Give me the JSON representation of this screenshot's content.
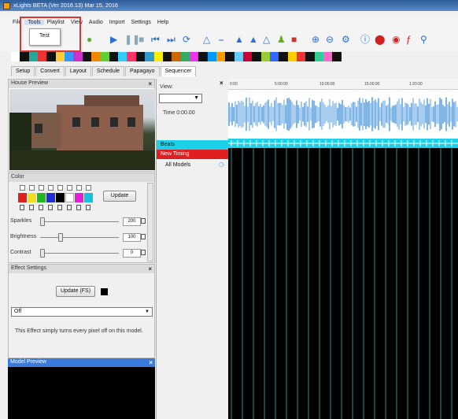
{
  "window": {
    "title": "xLights BETA (Ver 2016.13) Mar 15, 2016"
  },
  "menu": {
    "items": [
      "File",
      "Tools",
      "Playlist",
      "View",
      "Audio",
      "Import",
      "Settings",
      "Help"
    ],
    "active_index": 1,
    "dropdown_items": [
      "Test"
    ]
  },
  "tabs": [
    "Setup",
    "Convert",
    "Layout",
    "Schedule",
    "Papagayo",
    "Sequencer"
  ],
  "active_tab": "Sequencer",
  "house_preview": {
    "title": "House Preview"
  },
  "color_panel": {
    "title": "Color",
    "update_label": "Update",
    "palette": [
      "#e31e1e",
      "#f0e020",
      "#1fb820",
      "#1a30d8",
      "#000000",
      "#ffffff",
      "#e020d8",
      "#18c0e0"
    ],
    "sliders": [
      {
        "label": "Sparkles",
        "value": "200"
      },
      {
        "label": "Brightness",
        "value": "100"
      },
      {
        "label": "Contrast",
        "value": "0"
      }
    ]
  },
  "effect_settings": {
    "title": "Effect Settings",
    "update_fs_label": "Update (FS)",
    "selected_effect": "Off",
    "description": "This Effect simply turns every pixel off on this model."
  },
  "model_preview": {
    "title": "Model Preview"
  },
  "sequencer": {
    "view_label": "View:",
    "time_label": "Time 0:00.00",
    "rows": [
      {
        "label": "Beats",
        "color": "#1bd0e8"
      },
      {
        "label": "New Timing",
        "color": "#e02020"
      },
      {
        "label": "All Models",
        "color": "#f0f0f0"
      }
    ],
    "timeline_ticks": [
      "0:00",
      "5:00:00",
      "10:00:00",
      "15:00:00",
      "1:20:00"
    ]
  },
  "colors": {
    "accent_red": "#e3342f",
    "panel_blue": "#3c7bdc",
    "beats_cyan": "#1bd0e8"
  }
}
